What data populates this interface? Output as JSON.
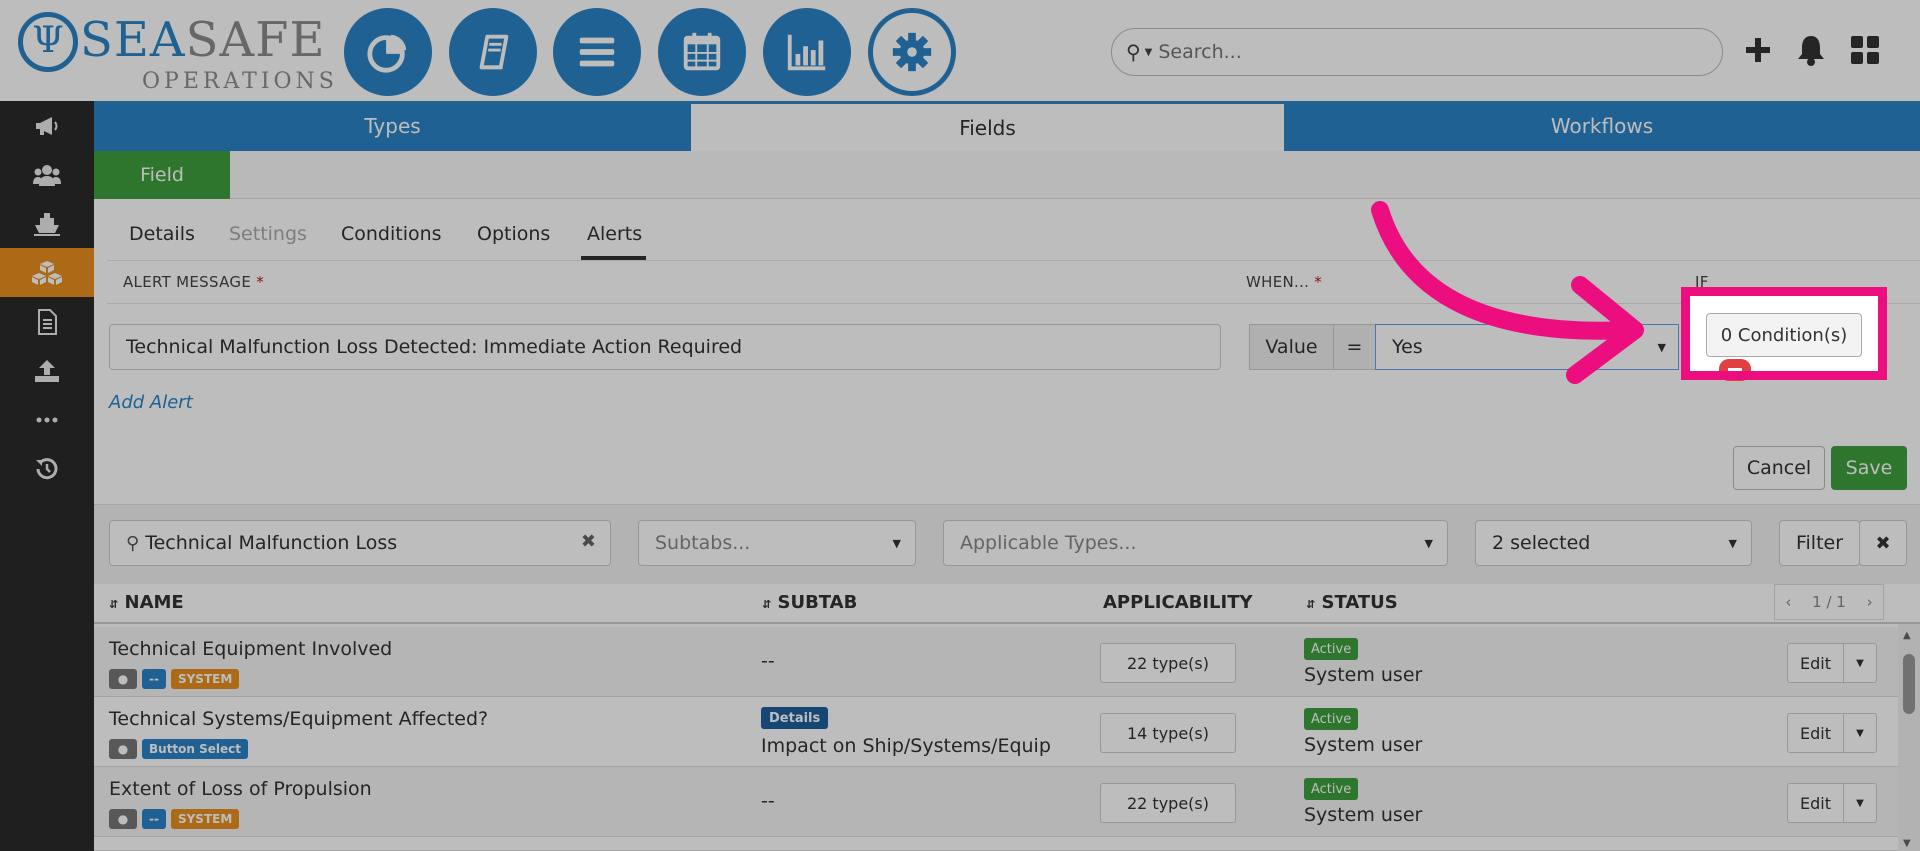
{
  "brand": {
    "name_part1": "SEA",
    "name_part2": "SAFE",
    "subtitle": "OPERATIONS",
    "accent_color": "#2a84c6"
  },
  "header": {
    "nav_buttons": [
      "dashboard-pie-icon",
      "logbook-icon",
      "menu-list-icon",
      "calendar-icon",
      "bar-chart-icon",
      "settings-gear-icon"
    ],
    "search_placeholder": "Search...",
    "icons": [
      "plus-icon",
      "bell-icon",
      "grid-apps-icon"
    ]
  },
  "sidebar": {
    "items": [
      "megaphone-icon",
      "users-icon",
      "ship-icon",
      "cubes-icon",
      "document-icon",
      "upload-icon",
      "more-icon",
      "history-icon"
    ],
    "active_index": 3,
    "active_color": "#e8901e"
  },
  "main_tabs": [
    {
      "label": "Types"
    },
    {
      "label": "Fields"
    },
    {
      "label": "Workflows"
    }
  ],
  "field_button": "Field",
  "sub_tabs": [
    {
      "label": "Details"
    },
    {
      "label": "Settings"
    },
    {
      "label": "Conditions"
    },
    {
      "label": "Options"
    },
    {
      "label": "Alerts"
    }
  ],
  "alerts": {
    "col_message": "ALERT MESSAGE",
    "col_when": "WHEN...",
    "col_if": "IF",
    "required_mark": "*",
    "message_value": "Technical Malfunction Loss Detected: Immediate Action Required",
    "value_addon": "Value",
    "equals_addon": "=",
    "selected_value": "Yes",
    "conditions_button": "0 Condition(s)",
    "add_alert": "Add Alert",
    "cancel": "Cancel",
    "save": "Save"
  },
  "filters": {
    "search_value": "Technical Malfunction Loss",
    "subtabs_placeholder": "Subtabs...",
    "types_placeholder": "Applicable Types...",
    "selected_label": "2 selected",
    "filter_button": "Filter",
    "clear_button": "✖"
  },
  "table": {
    "headers": [
      "NAME",
      "SUBTAB",
      "APPLICABILITY",
      "STATUS"
    ],
    "pager": "1 / 1",
    "rows": [
      {
        "name": "Technical Equipment Involved",
        "badges": [
          "--",
          "SYSTEM"
        ],
        "subtab": "--",
        "types": "22 type(s)",
        "status": "Active",
        "user": "System user",
        "edit": "Edit"
      },
      {
        "name": "Technical Systems/Equipment Affected?",
        "badges": [
          "Button Select"
        ],
        "subtab_badge": "Details",
        "subtab": "Impact on Ship/Systems/Equip",
        "types": "14 type(s)",
        "status": "Active",
        "user": "System user",
        "edit": "Edit"
      },
      {
        "name": "Extent of Loss of Propulsion",
        "badges": [
          "--",
          "SYSTEM"
        ],
        "subtab": "--",
        "types": "22 type(s)",
        "status": "Active",
        "user": "System user",
        "edit": "Edit"
      }
    ]
  },
  "highlight_color": "#ec0e7e"
}
